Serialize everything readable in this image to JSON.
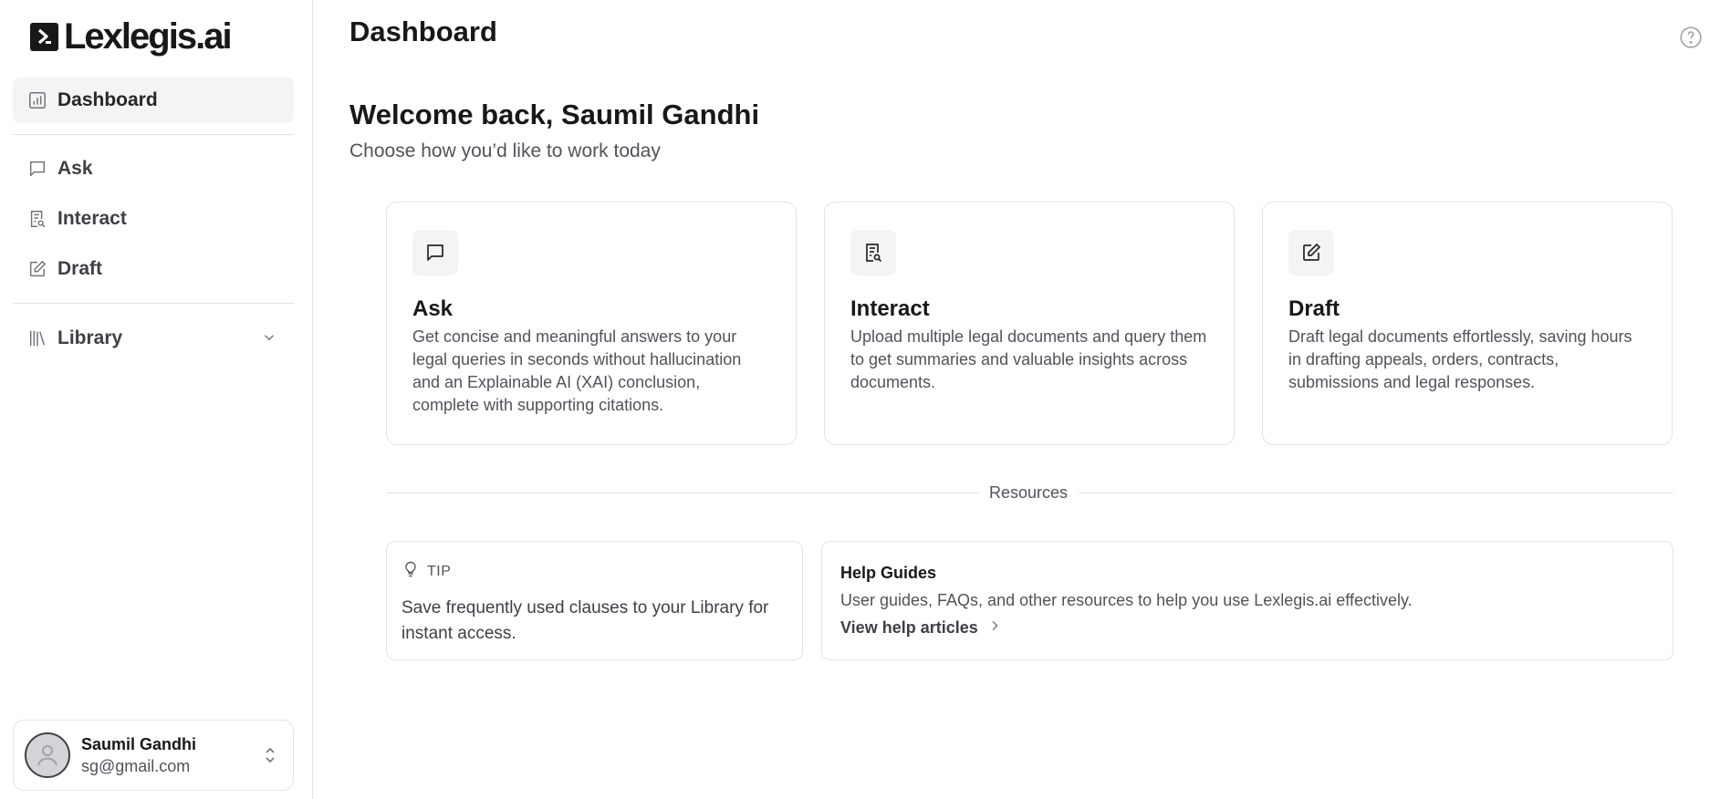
{
  "brand": {
    "name": "Lexlegis.ai"
  },
  "sidebar": {
    "items": [
      {
        "label": "Dashboard",
        "icon": "chart-icon",
        "active": true
      },
      {
        "label": "Ask",
        "icon": "chat-icon"
      },
      {
        "label": "Interact",
        "icon": "document-search-icon"
      },
      {
        "label": "Draft",
        "icon": "edit-icon"
      },
      {
        "label": "Library",
        "icon": "library-icon"
      }
    ]
  },
  "user": {
    "name": "Saumil Gandhi",
    "email": "sg@gmail.com"
  },
  "header": {
    "title": "Dashboard",
    "help_icon": "help-circle-icon"
  },
  "welcome": {
    "title": "Welcome back, Saumil Gandhi",
    "subtitle": "Choose how you’d like to work today"
  },
  "cards": [
    {
      "title": "Ask",
      "icon": "chat-icon",
      "description": "Get concise and meaningful answers to your legal queries in seconds without hallucination and an Explainable AI (XAI) conclusion, complete with supporting citations."
    },
    {
      "title": "Interact",
      "icon": "document-search-icon",
      "description": "Upload multiple legal documents and query them to get summaries and valuable insights across documents."
    },
    {
      "title": "Draft",
      "icon": "edit-icon",
      "description": "Draft legal documents effortlessly, saving hours in drafting appeals, orders, contracts, submissions and legal responses."
    }
  ],
  "resources": {
    "label": "Resources",
    "tip": {
      "label": "TIP",
      "text": "Save frequently used clauses to your Library for instant access."
    },
    "help": {
      "title": "Help Guides",
      "description": "User guides, FAQs, and other resources to help you use Lexlegis.ai effectively.",
      "link": "View help articles"
    }
  }
}
